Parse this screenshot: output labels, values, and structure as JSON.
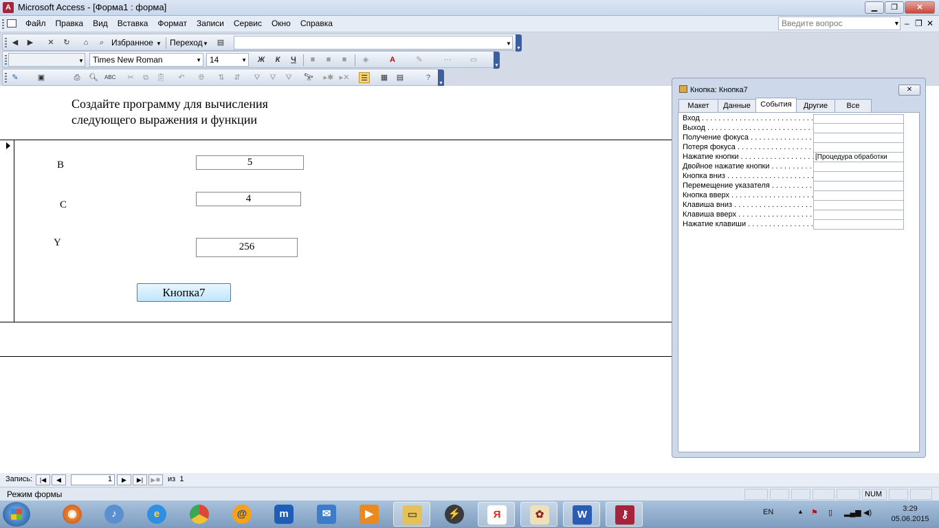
{
  "window": {
    "title": "Microsoft Access - [Форма1 : форма]"
  },
  "menu": {
    "items": [
      "Файл",
      "Правка",
      "Вид",
      "Вставка",
      "Формат",
      "Записи",
      "Сервис",
      "Окно",
      "Справка"
    ],
    "ask_placeholder": "Введите вопрос"
  },
  "toolbar_web": {
    "favorites": "Избранное",
    "goto": "Переход",
    "address": ""
  },
  "toolbar_format": {
    "object": "",
    "font": "Times New Roman",
    "size": "14",
    "bold": "Ж",
    "italic": "К",
    "underline": "Ч"
  },
  "form": {
    "heading_line1": "Создайте программу для вычисления",
    "heading_line2": "следующего выражения и функции",
    "label_b": "B",
    "label_c": "C",
    "label_y": "Y",
    "value_b": "5",
    "value_c": "4",
    "value_y": "256",
    "button": "Кнопка7"
  },
  "navigation": {
    "label": "Запись:",
    "current": "1",
    "of": "из",
    "total": "1"
  },
  "status": {
    "text": "Режим формы",
    "num": "NUM"
  },
  "property_sheet": {
    "title": "Кнопка: Кнопка7",
    "tabs": [
      "Макет",
      "Данные",
      "События",
      "Другие",
      "Все"
    ],
    "active_tab": "События",
    "rows": [
      {
        "name": "Вход . . . . . . . . . . . . . . . . . . . . . . . . . . . . . .",
        "value": ""
      },
      {
        "name": "Выход . . . . . . . . . . . . . . . . . . . . . . . . . . . . .",
        "value": ""
      },
      {
        "name": "Получение фокуса . . . . . . . . . . . . . . . . .",
        "value": ""
      },
      {
        "name": "Потеря фокуса . . . . . . . . . . . . . . . . . . . .",
        "value": ""
      },
      {
        "name": "Нажатие кнопки . . . . . . . . . . . . . . . . . .",
        "value": "[Процедура обработки"
      },
      {
        "name": "Двойное нажатие кнопки . . . . . . . . . . .",
        "value": ""
      },
      {
        "name": "Кнопка вниз . . . . . . . . . . . . . . . . . . . . .",
        "value": ""
      },
      {
        "name": "Перемещение указателя . . . . . . . . . . .",
        "value": ""
      },
      {
        "name": "Кнопка вверх . . . . . . . . . . . . . . . . . . . .",
        "value": ""
      },
      {
        "name": "Клавиша вниз . . . . . . . . . . . . . . . . . . . .",
        "value": ""
      },
      {
        "name": "Клавиша вверх . . . . . . . . . . . . . . . . . . .",
        "value": ""
      },
      {
        "name": "Нажатие клавиши . . . . . . . . . . . . . . . . .",
        "value": ""
      }
    ]
  },
  "taskbar": {
    "lang": "EN",
    "time": "3:29",
    "date": "05.06.2015",
    "apps": [
      "firefox-icon",
      "volume-icon",
      "ie-icon",
      "chrome-icon",
      "mail-ru-icon",
      "maxthon-icon",
      "mail-icon",
      "video-icon",
      "explorer-icon",
      "winamp-icon",
      "yandex-icon",
      "mahjong-icon",
      "word-icon",
      "access-icon"
    ]
  }
}
